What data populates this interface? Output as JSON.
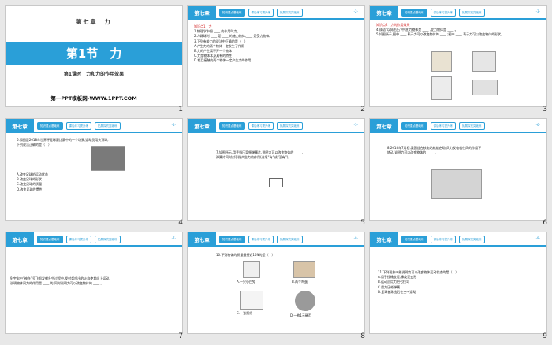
{
  "slides": [
    {
      "number": "1",
      "chapter": "第七章　力",
      "title": "第1节　力",
      "subtitle": "第1课时　力和力的作用效果",
      "site": "第一PPT模板网-WWW.1PPT.COM"
    },
    {
      "number": "2",
      "chapter_tab": "第七章",
      "tabs": [
        "知识要点基础练",
        "课后练习提升练",
        "拓展探究突破练"
      ],
      "page_indicator": "-2-",
      "lines": [
        "知识点1　力",
        "1.物理学中把 ____ 的作用叫力。",
        "2.人踢球时 ____ 是 ____ 的施力物体,____ 是受力物体。",
        "3.下列有关力的说法中正确的是（　）",
        "A.产生力的两个物体一定发生了作用",
        "B.力的产生离不开一个物体",
        "C.力是物体本身具有的特性",
        "D.相互接触的两个物体一定产生力的作用"
      ]
    },
    {
      "number": "3",
      "chapter_tab": "第七章",
      "tabs": [
        "知识要点基础练",
        "课后练习提升练",
        "拓展探究突破练"
      ],
      "page_indicator": "-3-",
      "lines": [
        "知识点2　力的作用效果",
        "4.成语“以卵击石”中,施力物体是 ____ ,受力物体是 ____ 。",
        "5.如图所示,图中 ____ 表示力可以改变物体的 ____ ;图中 ____ 表示力可以改变物体的形状。"
      ]
    },
    {
      "number": "4",
      "chapter_tab": "第七章",
      "tabs": [
        "知识要点基础练",
        "课后练习提升练",
        "拓展探究突破练"
      ],
      "page_indicator": "-4-",
      "lines": [
        "6.如图是2018年世界杯足球赛比赛中的一个场景,运动员用头顶球,",
        "下列说法正确的是（　）",
        "A.改变足球的运动状态",
        "B.改变足球的形状",
        "C.改变足球的质量",
        "D.改变足球的惯性"
      ]
    },
    {
      "number": "5",
      "chapter_tab": "第七章",
      "tabs": [
        "知识要点基础练",
        "课后练习提升练",
        "拓展探究突破练"
      ],
      "page_indicator": "-5-",
      "lines": [
        "7.如图所示,用手指压弯细弹簧片,说明力可以改变物体的 ____ ,",
        "弹簧片同时对手指产生力的作用(选填“有”或“没有”)。"
      ]
    },
    {
      "number": "6",
      "chapter_tab": "第七章",
      "tabs": [
        "知识要点基础练",
        "课后练习提升练",
        "拓展探究突破练"
      ],
      "page_indicator": "-6-",
      "lines": [
        "8.2018年7月初,我国首台核电站机组启动,风力发电机在风的作用下",
        "转动,说明力可以改变物体的 ____ 。"
      ]
    },
    {
      "number": "7",
      "chapter_tab": "第七章",
      "tabs": [
        "知识要点基础练",
        "课后练习提升练",
        "拓展探究突破练"
      ],
      "page_indicator": "-7-",
      "lines": [
        "9.宇宙中“神舟”号飞船发射升空过程中,发射架喷出的火焰使其向上运动,",
        "说明物体间力的作用是 ____ 的,同时说明力可以改变物体的 ____ 。"
      ]
    },
    {
      "number": "8",
      "chapter_tab": "第七章",
      "tabs": [
        "知识要点基础练",
        "课后练习提升练",
        "拓展探究突破练"
      ],
      "page_indicator": "-8-",
      "lines": [
        "10.下列物体的质量最接近10N的是（　）"
      ],
      "options": [
        "A.一只小白兔",
        "B.两个鸡蛋",
        "C.一张报纸",
        "D.一枚1元硬币"
      ]
    },
    {
      "number": "9",
      "chapter_tab": "第七章",
      "tabs": [
        "知识要点基础练",
        "课后练习提升练",
        "拓展探究突破练"
      ],
      "page_indicator": "-9-",
      "lines": [
        "11.下列现象中能说明力可以改变物体运动状态的是（　）",
        "A.用手捏橡皮泥,橡皮泥变形",
        "B.运动员用力把弓拉弯",
        "C.用力压缩弹簧",
        "D.足球被踢出后在空中运动"
      ]
    }
  ],
  "colors": {
    "accent": "#2a9fd8"
  }
}
